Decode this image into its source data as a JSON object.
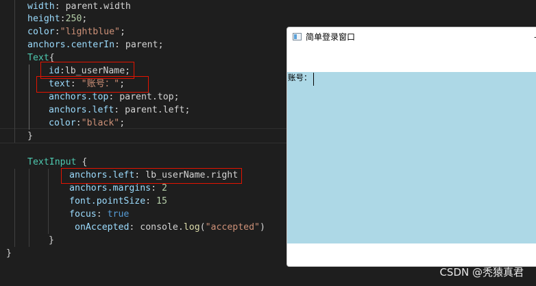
{
  "code_lines": [
    {
      "parts": [
        {
          "t": "width",
          "c": "c-prop"
        },
        {
          "t": ": parent.width",
          "c": "c-punc"
        }
      ]
    },
    {
      "parts": [
        {
          "t": "height",
          "c": "c-prop"
        },
        {
          "t": ":",
          "c": "c-punc"
        },
        {
          "t": "250",
          "c": "c-num"
        },
        {
          "t": ";",
          "c": "c-punc"
        }
      ]
    },
    {
      "parts": [
        {
          "t": "color",
          "c": "c-prop"
        },
        {
          "t": ":",
          "c": "c-punc"
        },
        {
          "t": "\"lightblue\"",
          "c": "c-str"
        },
        {
          "t": ";",
          "c": "c-punc"
        }
      ]
    },
    {
      "parts": [
        {
          "t": "anchors.centerIn",
          "c": "c-prop"
        },
        {
          "t": ": parent;",
          "c": "c-punc"
        }
      ]
    },
    {
      "parts": [
        {
          "t": "Text",
          "c": "c-type"
        },
        {
          "t": "{",
          "c": "c-punc"
        }
      ]
    },
    {
      "parts": [
        {
          "t": "id",
          "c": "c-prop"
        },
        {
          "t": ":lb_userName;",
          "c": "c-punc"
        }
      ]
    },
    {
      "parts": [
        {
          "t": "text",
          "c": "c-prop"
        },
        {
          "t": ": ",
          "c": "c-punc"
        },
        {
          "t": "\"账号：\"",
          "c": "c-str"
        },
        {
          "t": ";",
          "c": "c-punc"
        }
      ]
    },
    {
      "parts": [
        {
          "t": "anchors.top",
          "c": "c-prop"
        },
        {
          "t": ": parent.top;",
          "c": "c-punc"
        }
      ]
    },
    {
      "parts": [
        {
          "t": "anchors.left",
          "c": "c-prop"
        },
        {
          "t": ": parent.left;",
          "c": "c-punc"
        }
      ]
    },
    {
      "parts": [
        {
          "t": "color",
          "c": "c-prop"
        },
        {
          "t": ":",
          "c": "c-punc"
        },
        {
          "t": "\"black\"",
          "c": "c-str"
        },
        {
          "t": ";",
          "c": "c-punc"
        }
      ]
    },
    {
      "parts": [
        {
          "t": "}",
          "c": "c-punc"
        }
      ]
    },
    {
      "parts": []
    },
    {
      "parts": [
        {
          "t": "TextInput",
          "c": "c-type"
        },
        {
          "t": " {",
          "c": "c-punc"
        }
      ]
    },
    {
      "parts": [
        {
          "t": "anchors.left",
          "c": "c-prop"
        },
        {
          "t": ": lb_userName.right",
          "c": "c-punc"
        }
      ]
    },
    {
      "parts": [
        {
          "t": "anchors.margins",
          "c": "c-prop"
        },
        {
          "t": ": ",
          "c": "c-punc"
        },
        {
          "t": "2",
          "c": "c-num"
        }
      ]
    },
    {
      "parts": [
        {
          "t": "font.pointSize",
          "c": "c-prop"
        },
        {
          "t": ": ",
          "c": "c-punc"
        },
        {
          "t": "15",
          "c": "c-num"
        }
      ]
    },
    {
      "parts": [
        {
          "t": "focus",
          "c": "c-prop"
        },
        {
          "t": ": ",
          "c": "c-punc"
        },
        {
          "t": "true",
          "c": "c-kw"
        }
      ]
    },
    {
      "parts": [
        {
          "t": "onAccepted",
          "c": "c-prop"
        },
        {
          "t": ": console.",
          "c": "c-punc"
        },
        {
          "t": "log",
          "c": "c-fn"
        },
        {
          "t": "(",
          "c": "c-punc"
        },
        {
          "t": "\"accepted\"",
          "c": "c-str"
        },
        {
          "t": ")",
          "c": "c-punc"
        }
      ]
    },
    {
      "parts": [
        {
          "t": "}",
          "c": "c-punc"
        }
      ]
    },
    {
      "parts": [
        {
          "t": "}",
          "c": "c-punc"
        }
      ]
    }
  ],
  "window": {
    "title": "简单登录窗口",
    "minimize_glyph": "–",
    "label_text": "账号："
  },
  "watermark": "CSDN @秃猿真君",
  "icons": [
    "app-window-icon"
  ]
}
